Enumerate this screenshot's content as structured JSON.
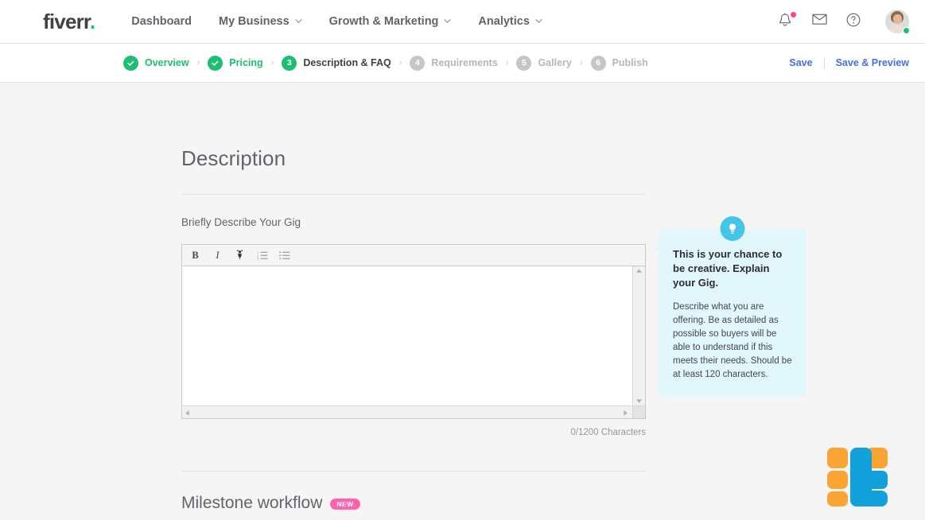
{
  "nav": {
    "brand": "fiverr",
    "brand_dot": ".",
    "links": [
      {
        "label": "Dashboard",
        "has_caret": false
      },
      {
        "label": "My Business",
        "has_caret": true
      },
      {
        "label": "Growth & Marketing",
        "has_caret": true
      },
      {
        "label": "Analytics",
        "has_caret": true
      }
    ],
    "icons": {
      "notifications": "bell-icon",
      "messages": "envelope-icon",
      "help": "question-circle-icon",
      "avatar": "avatar",
      "online_status": "online"
    }
  },
  "steps": {
    "items": [
      {
        "num": "1",
        "label": "Overview",
        "state": "done"
      },
      {
        "num": "2",
        "label": "Pricing",
        "state": "done"
      },
      {
        "num": "3",
        "label": "Description & FAQ",
        "state": "active"
      },
      {
        "num": "4",
        "label": "Requirements",
        "state": "todo"
      },
      {
        "num": "5",
        "label": "Gallery",
        "state": "todo"
      },
      {
        "num": "6",
        "label": "Publish",
        "state": "todo"
      }
    ],
    "separator": "›",
    "save_label": "Save",
    "save_preview_label": "Save & Preview"
  },
  "main": {
    "section_title": "Description",
    "field_label": "Briefly Describe Your Gig",
    "editor": {
      "value": "",
      "placeholder": "",
      "tools": [
        {
          "name": "bold-icon",
          "glyph": "B"
        },
        {
          "name": "italic-icon",
          "glyph": "I"
        },
        {
          "name": "highlighter-icon",
          "glyph": ""
        },
        {
          "name": "ordered-list-icon",
          "glyph": ""
        },
        {
          "name": "unordered-list-icon",
          "glyph": ""
        }
      ]
    },
    "char_count": "0/1200 Characters",
    "milestone_title": "Milestone workflow",
    "milestone_badge": "NEW"
  },
  "tooltip": {
    "icon": "lightbulb-icon",
    "title": "This is your chance to be creative. Explain your Gig.",
    "body": "Describe what you are offering. Be as detailed as possible so buyers will be able to understand if this meets their needs. Should be at least 120 characters."
  },
  "colors": {
    "brand_green": "#1dbf73",
    "link_blue": "#446ee7",
    "tooltip_bg": "#e1f7fc",
    "tooltip_accent": "#46c6e6",
    "badge_pink": "#ff62ad",
    "notification_dot": "#ff3f8e",
    "logo_orange": "#f9a433",
    "logo_blue": "#12a1db",
    "page_bg": "#f5f5f5"
  }
}
